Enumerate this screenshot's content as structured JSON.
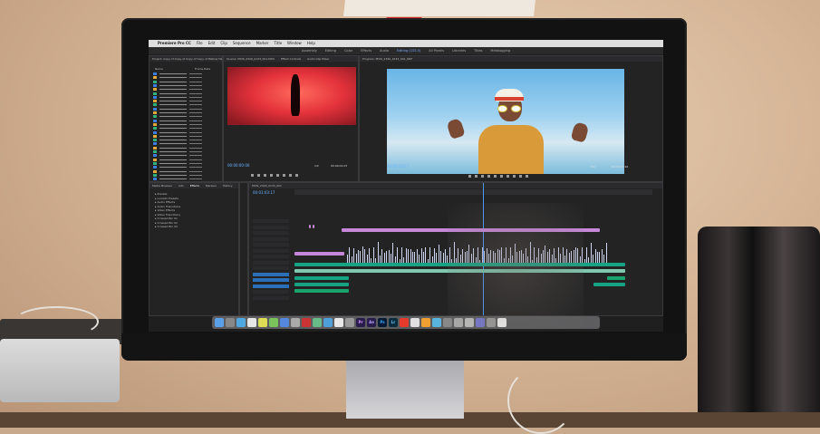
{
  "menubar": {
    "app": "Premiere Pro CC",
    "items": [
      "File",
      "Edit",
      "Clip",
      "Sequence",
      "Marker",
      "Title",
      "Window",
      "Help"
    ]
  },
  "workspaces": {
    "tabs": [
      "Assembly",
      "Editing",
      "Color",
      "Effects",
      "Audio",
      "Editing (CS5.5)",
      "All Panels",
      "Libraries",
      "Titles",
      "Metalogging"
    ],
    "active": "Editing (CS5.5)"
  },
  "panels": {
    "project_title": "Project: Copy of Copy of Copy of Copy of Mellow Haus",
    "source_title": "Source: MVI0_2320_0133_001.MOV",
    "effect_controls": "Effect Controls",
    "audio_mixer": "Audio Clip Mixer",
    "program_title": "Program: MVI0_2320_0133_001_ORF",
    "timeline_title": "MVI0_2320_0133_001",
    "effects_tab": "Effects",
    "markers_tab": "Markers",
    "history_tab": "History",
    "media_browser": "Media Browser",
    "info_tab": "Info",
    "column_name": "Name",
    "column_fps": "Frame Rate"
  },
  "timecodes": {
    "source_current": "00:00:00:00",
    "source_duration": "00:00:01:07",
    "program_current": "00:00:33:17",
    "program_duration": "00:00:55:16",
    "timeline_current": "00:01:03:17",
    "source_fit": "1/2",
    "program_fit": "Full"
  },
  "effects_tree": [
    "Presets",
    "Lumetri Presets",
    "Audio Effects",
    "Audio Transitions",
    "Video Effects",
    "Video Transitions",
    "Crossed Bin 01",
    "Crossed Bin 02",
    "Crossed Bin 03"
  ],
  "dock_labels": [
    "Pr",
    "Ae",
    "Ps",
    "Lr"
  ],
  "colors": {
    "source_frame": "#e4323b",
    "program_sky": "#69b5e6",
    "audio_clip": "#16a383",
    "video_clip": "#c687d9",
    "playhead": "#4a9bff"
  }
}
